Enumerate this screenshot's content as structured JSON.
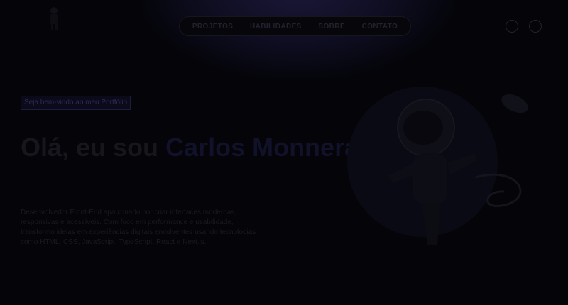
{
  "nav": {
    "links": [
      {
        "label": "PROJETOS"
      },
      {
        "label": "HABILIDADES"
      },
      {
        "label": "SOBRE"
      },
      {
        "label": "CONTATO"
      }
    ]
  },
  "icons": {
    "logo": "astronaut-logo",
    "actions": [
      "linkedin-icon",
      "github-icon"
    ]
  },
  "hero": {
    "badge": "Seja bem-vindo ao meu Portfólio",
    "greeting": "Olá, eu sou ",
    "name": "Carlos Monnerat",
    "description": "Desenvolvedor Front-End apaixonado por criar interfaces modernas, responsivas e acessíveis. Com foco em performance e usabilidade, transformo ideias em experiências digitais envolventes usando tecnologias como HTML, CSS, JavaScript, TypeScript, React e Next.js.",
    "illustration": "astronaut-illustration"
  },
  "colors": {
    "background": "#040409",
    "accent": "#11112a"
  }
}
